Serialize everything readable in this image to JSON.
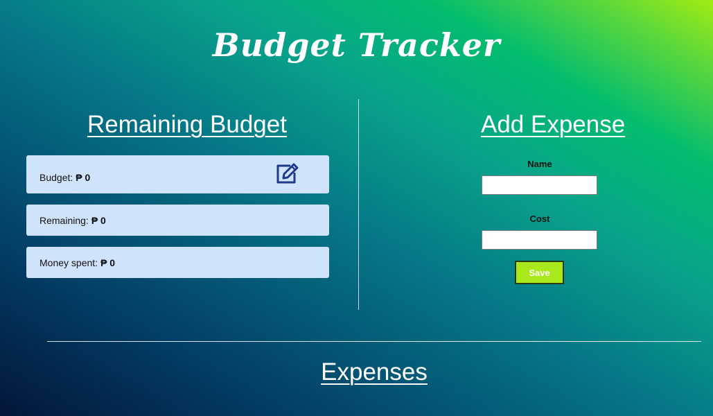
{
  "app": {
    "title": "Budget Tracker"
  },
  "remaining_section": {
    "heading": "Remaining Budget",
    "budget": {
      "label": "Budget:",
      "value": "₱ 0"
    },
    "remaining": {
      "label": "Remaining:",
      "value": "₱ 0"
    },
    "spent": {
      "label": "Money spent:",
      "value": "₱ 0"
    },
    "edit_icon": "edit-icon"
  },
  "add_expense": {
    "heading": "Add Expense",
    "name_label": "Name",
    "name_value": "",
    "cost_label": "Cost",
    "cost_value": "",
    "save_label": "Save"
  },
  "expenses_section": {
    "heading": "Expenses"
  },
  "colors": {
    "card_background": "#cfe3fb",
    "save_button": "#a9e81a",
    "icon_color": "#1f3a8a"
  }
}
